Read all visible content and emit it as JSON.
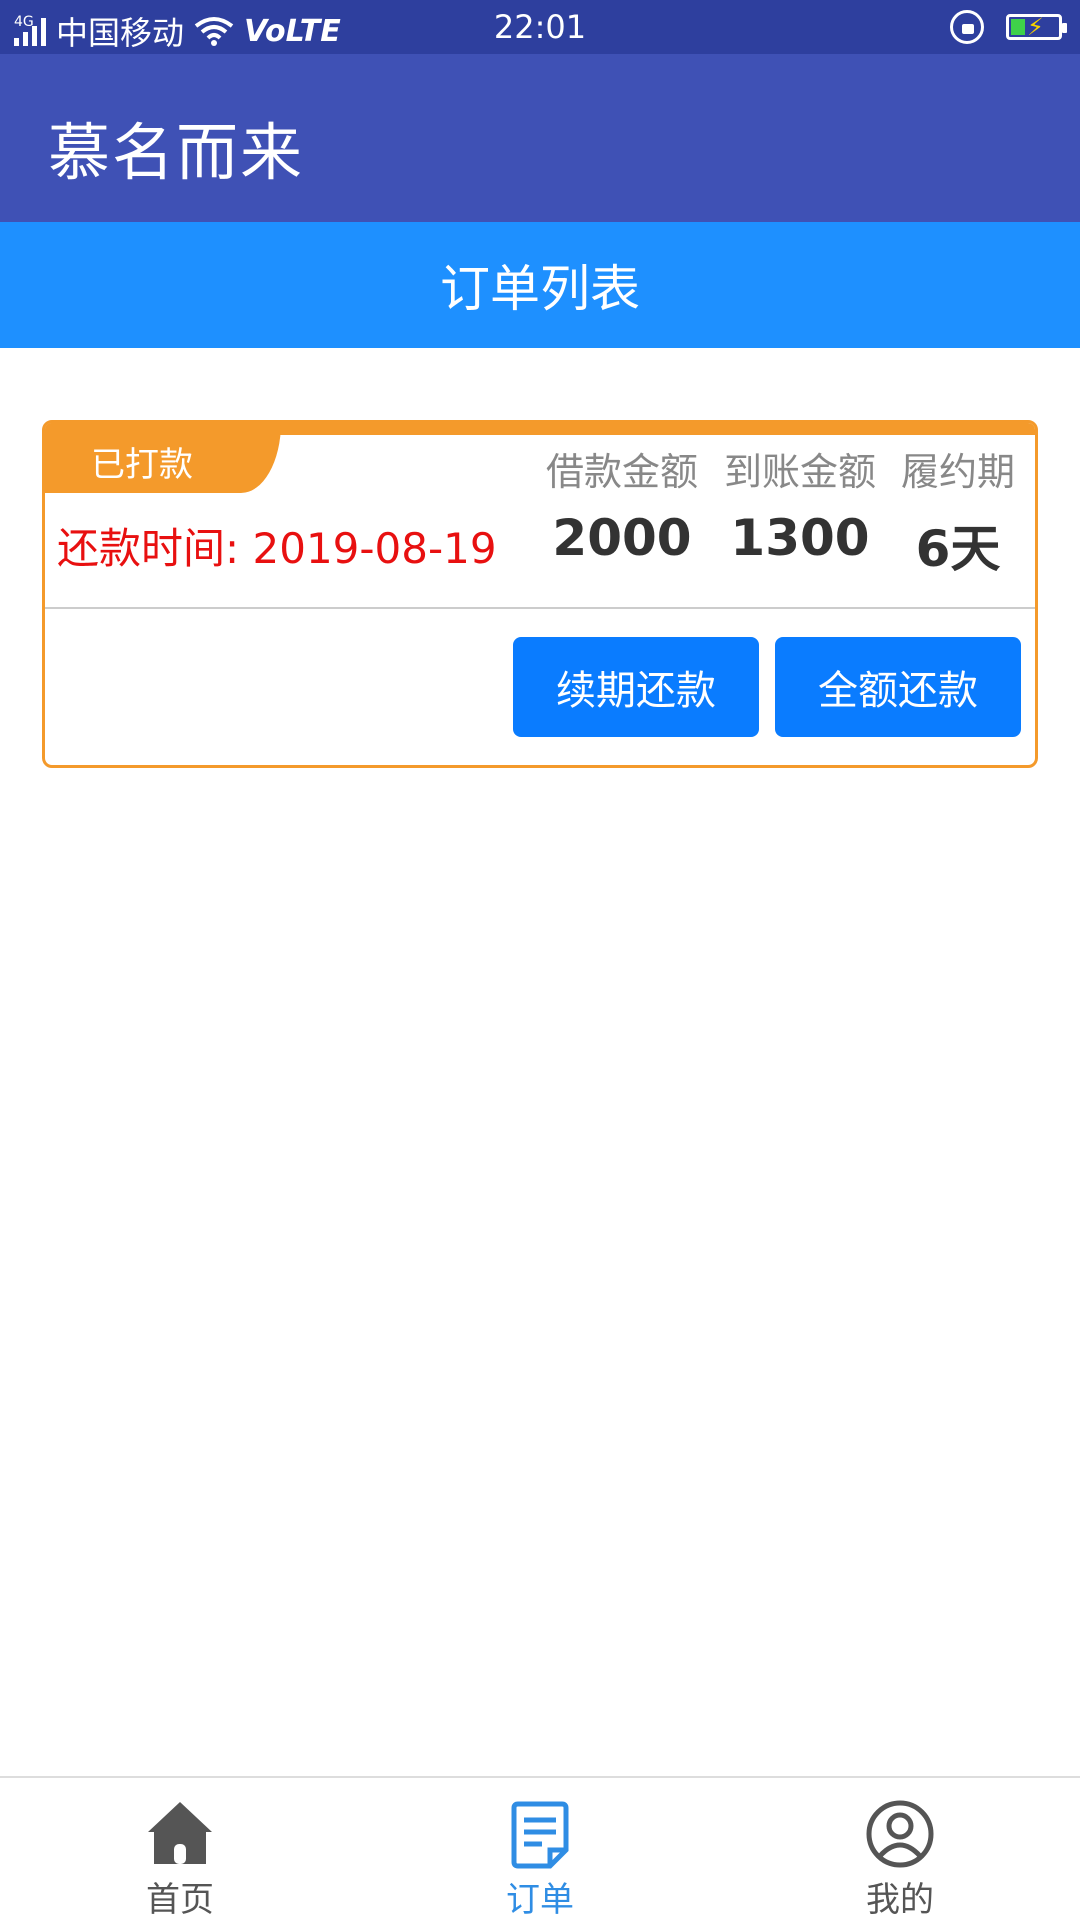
{
  "status_bar": {
    "network": "4G",
    "carrier": "中国移动",
    "volte": "VoLTE",
    "time": "22:01"
  },
  "app_bar": {
    "title": "慕名而来"
  },
  "sub_header": {
    "title": "订单列表"
  },
  "order": {
    "status": "已打款",
    "headers": [
      "借款金额",
      "到账金额",
      "履约期"
    ],
    "values": [
      "2000",
      "1300",
      "6天"
    ],
    "due_date": "还款时间: 2019-08-19",
    "buttons": {
      "renew": "续期还款",
      "full": "全额还款"
    }
  },
  "nav": {
    "items": [
      {
        "label": "首页",
        "icon": "home-icon"
      },
      {
        "label": "订单",
        "icon": "order-list-icon"
      },
      {
        "label": "我的",
        "icon": "user-icon"
      }
    ],
    "active_index": 1
  },
  "colors": {
    "status_bar": "#2e3f9e",
    "app_bar": "#3f51b5",
    "sub_header": "#1e90ff",
    "card_accent": "#f49a2b",
    "button": "#0a7cff",
    "due_text": "#e81010",
    "nav_active": "#2f8de4",
    "nav_inactive": "#555555"
  }
}
